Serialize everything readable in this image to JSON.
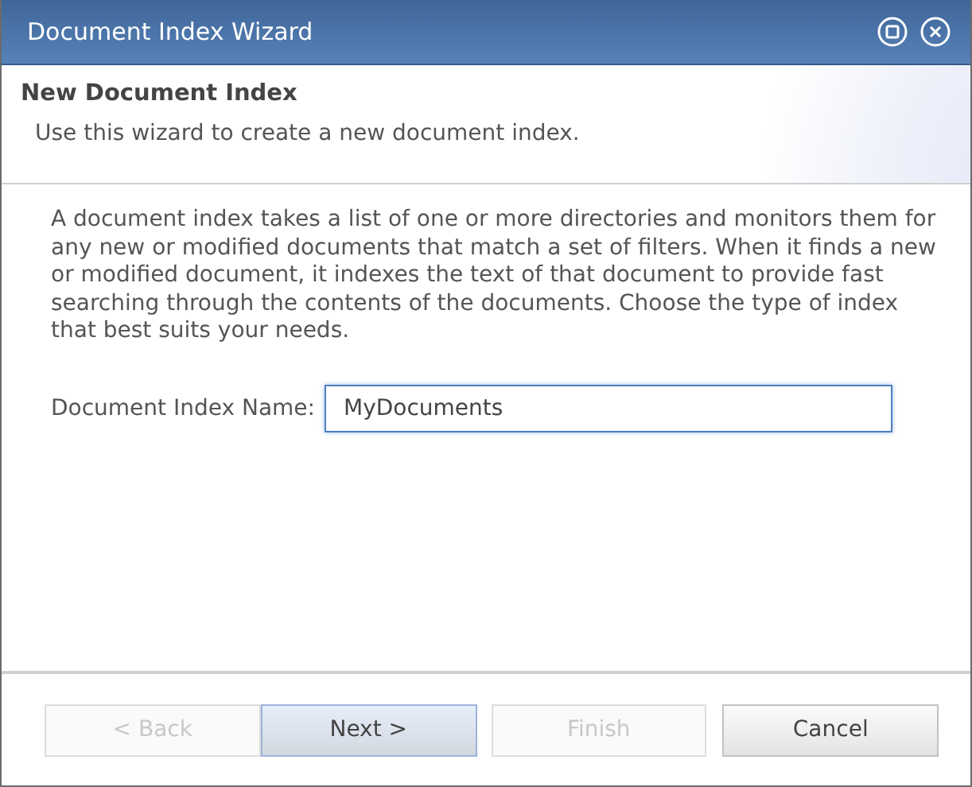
{
  "window": {
    "title": "Document Index Wizard"
  },
  "header": {
    "title": "New Document Index",
    "subtitle": "Use this wizard to create a new document index."
  },
  "description": "A document index takes a list of one or more directories and monitors them for any new or modified documents that match a set of filters. When it finds a new or modified document, it indexes the text of that document to provide fast searching through the contents of the documents.  Choose the type of index that best suits your needs.",
  "name_field": {
    "label": "Document Index Name:",
    "value": "MyDocuments",
    "focused": true
  },
  "buttons": [
    {
      "label": "< Back",
      "disabled": true,
      "highlighted": false
    },
    {
      "label": "Next >",
      "disabled": false,
      "highlighted": true
    },
    {
      "label": "Finish",
      "disabled": true,
      "highlighted": false
    },
    {
      "label": "Cancel",
      "disabled": false,
      "highlighted": false
    }
  ]
}
